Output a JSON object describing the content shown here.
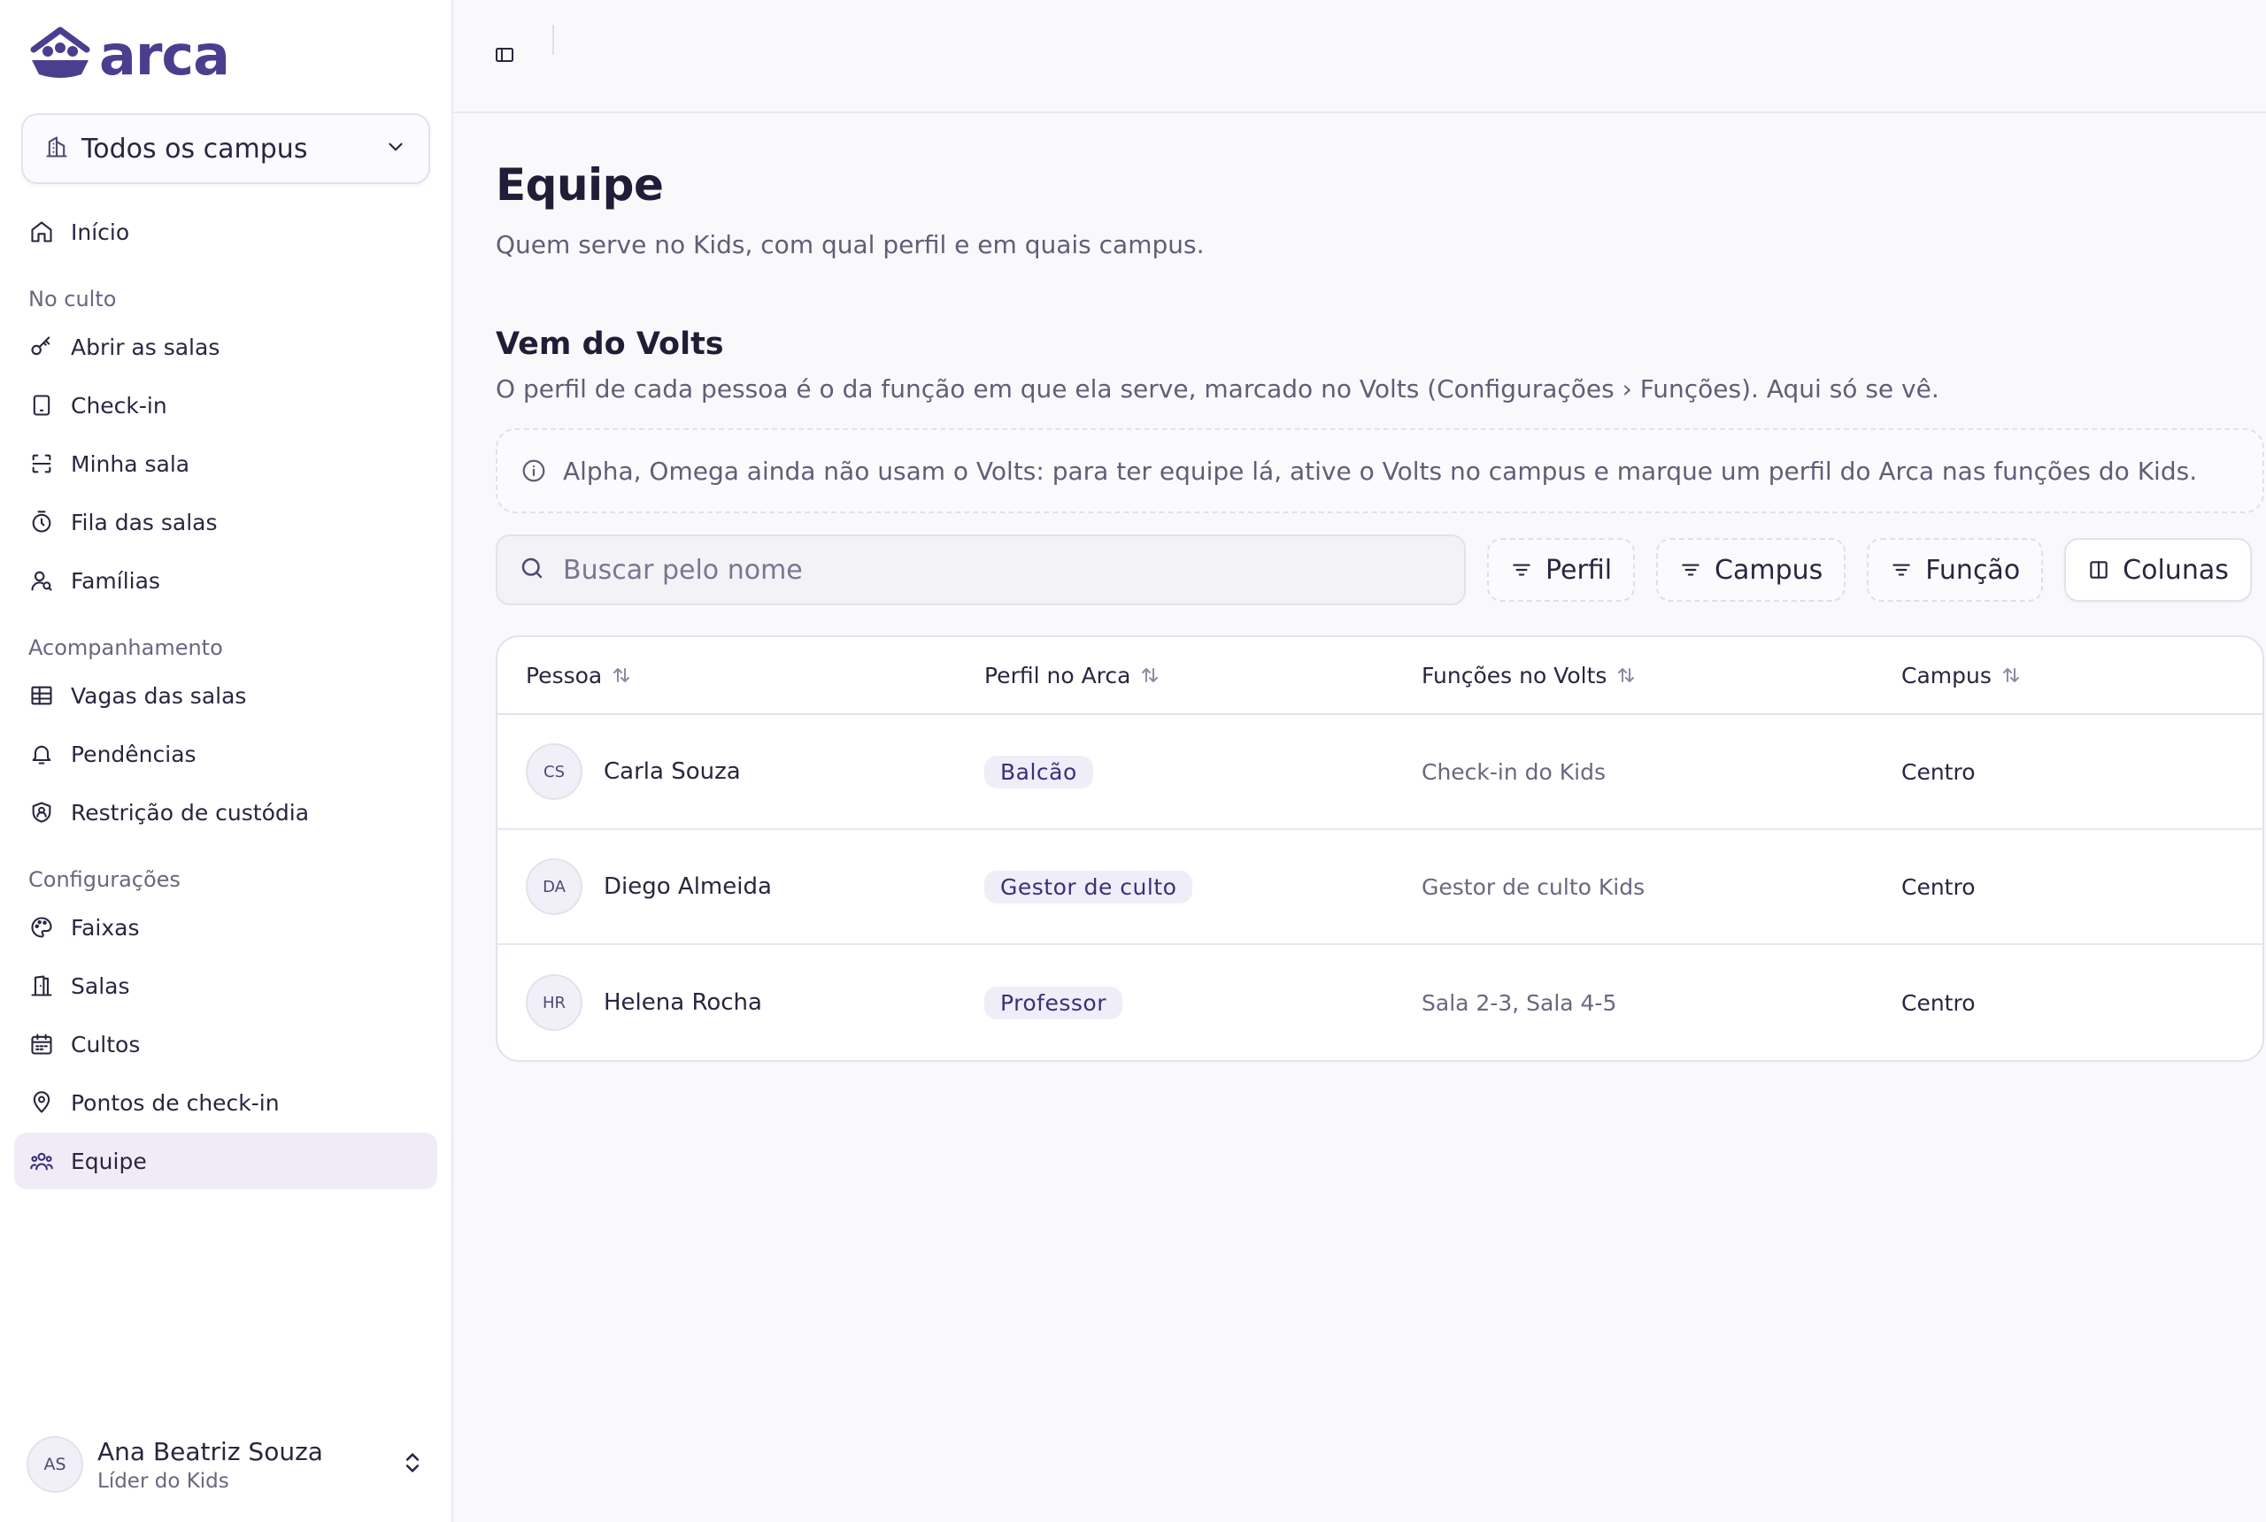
{
  "brand": {
    "name": "arca",
    "color": "#4a3f8f"
  },
  "campus_select": {
    "value": "Todos os campus"
  },
  "nav": {
    "home": "Início",
    "groups": [
      {
        "title": "No culto",
        "items": [
          "Abrir as salas",
          "Check-in",
          "Minha sala",
          "Fila das salas",
          "Famílias"
        ]
      },
      {
        "title": "Acompanhamento",
        "items": [
          "Vagas das salas",
          "Pendências",
          "Restrição de custódia"
        ]
      },
      {
        "title": "Configurações",
        "items": [
          "Faixas",
          "Salas",
          "Cultos",
          "Pontos de check-in",
          "Equipe"
        ]
      }
    ],
    "active": "Equipe"
  },
  "user": {
    "initials": "AS",
    "name": "Ana Beatriz Souza",
    "role": "Líder do Kids"
  },
  "page": {
    "title": "Equipe",
    "subtitle": "Quem serve no Kids, com qual perfil e em quais campus."
  },
  "section": {
    "title": "Vem do Volts",
    "subtitle": "O perfil de cada pessoa é o da função em que ela serve, marcado no Volts (Configurações › Funções). Aqui só se vê.",
    "notice": "Alpha, Omega ainda não usam o Volts: para ter equipe lá, ative o Volts no campus e marque um perfil do Arca nas funções do Kids."
  },
  "toolbar": {
    "search_placeholder": "Buscar pelo nome",
    "filters": [
      "Perfil",
      "Campus",
      "Função"
    ],
    "columns_label": "Colunas"
  },
  "table": {
    "headers": [
      "Pessoa",
      "Perfil no Arca",
      "Funções no Volts",
      "Campus"
    ],
    "rows": [
      {
        "initials": "CS",
        "name": "Carla Souza",
        "profile": "Balcão",
        "functions": "Check-in do Kids",
        "campus": "Centro"
      },
      {
        "initials": "DA",
        "name": "Diego Almeida",
        "profile": "Gestor de culto",
        "functions": "Gestor de culto Kids",
        "campus": "Centro"
      },
      {
        "initials": "HR",
        "name": "Helena Rocha",
        "profile": "Professor",
        "functions": "Sala 2-3, Sala 4-5",
        "campus": "Centro"
      }
    ]
  }
}
